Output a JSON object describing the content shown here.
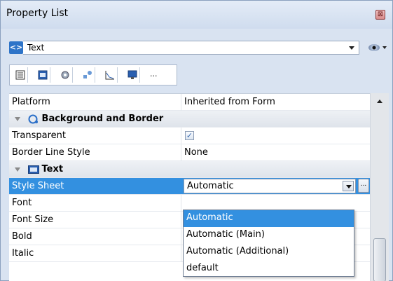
{
  "window": {
    "title": "Property List",
    "close_glyph": "⊠"
  },
  "object_selector": {
    "icon": "<>",
    "icon_name": "code-brackets-icon",
    "value": "Text",
    "view_icon": "eye-icon"
  },
  "tabs": [
    {
      "name": "tab-list",
      "icon": "list-icon"
    },
    {
      "name": "tab-form",
      "icon": "form-icon"
    },
    {
      "name": "tab-gear",
      "icon": "gear-icon"
    },
    {
      "name": "tab-shapes",
      "icon": "shapes-icon"
    },
    {
      "name": "tab-chart",
      "icon": "chart-icon"
    },
    {
      "name": "tab-monitor",
      "icon": "monitor-icon"
    },
    {
      "name": "tab-more",
      "icon": "more-icon",
      "glyph": "..."
    }
  ],
  "rows": {
    "platform": {
      "name": "Platform",
      "value": "Inherited from Form"
    },
    "bg_group": {
      "name": "Background and Border"
    },
    "transparent": {
      "name": "Transparent",
      "checked": true,
      "check": "✓"
    },
    "border_line": {
      "name": "Border Line Style",
      "value": "None"
    },
    "text_group": {
      "name": "Text"
    },
    "style_sheet": {
      "name": "Style Sheet",
      "value": "Automatic"
    },
    "font": {
      "name": "Font"
    },
    "font_size": {
      "name": "Font Size"
    },
    "bold": {
      "name": "Bold"
    },
    "italic": {
      "name": "Italic"
    }
  },
  "ellipsis": "...",
  "dropdown": {
    "options": [
      "Automatic",
      "Automatic (Main)",
      "Automatic (Additional)",
      "default"
    ],
    "selected_index": 0
  },
  "colors": {
    "selection": "#3390e0",
    "panel": "#d9e3f1"
  }
}
